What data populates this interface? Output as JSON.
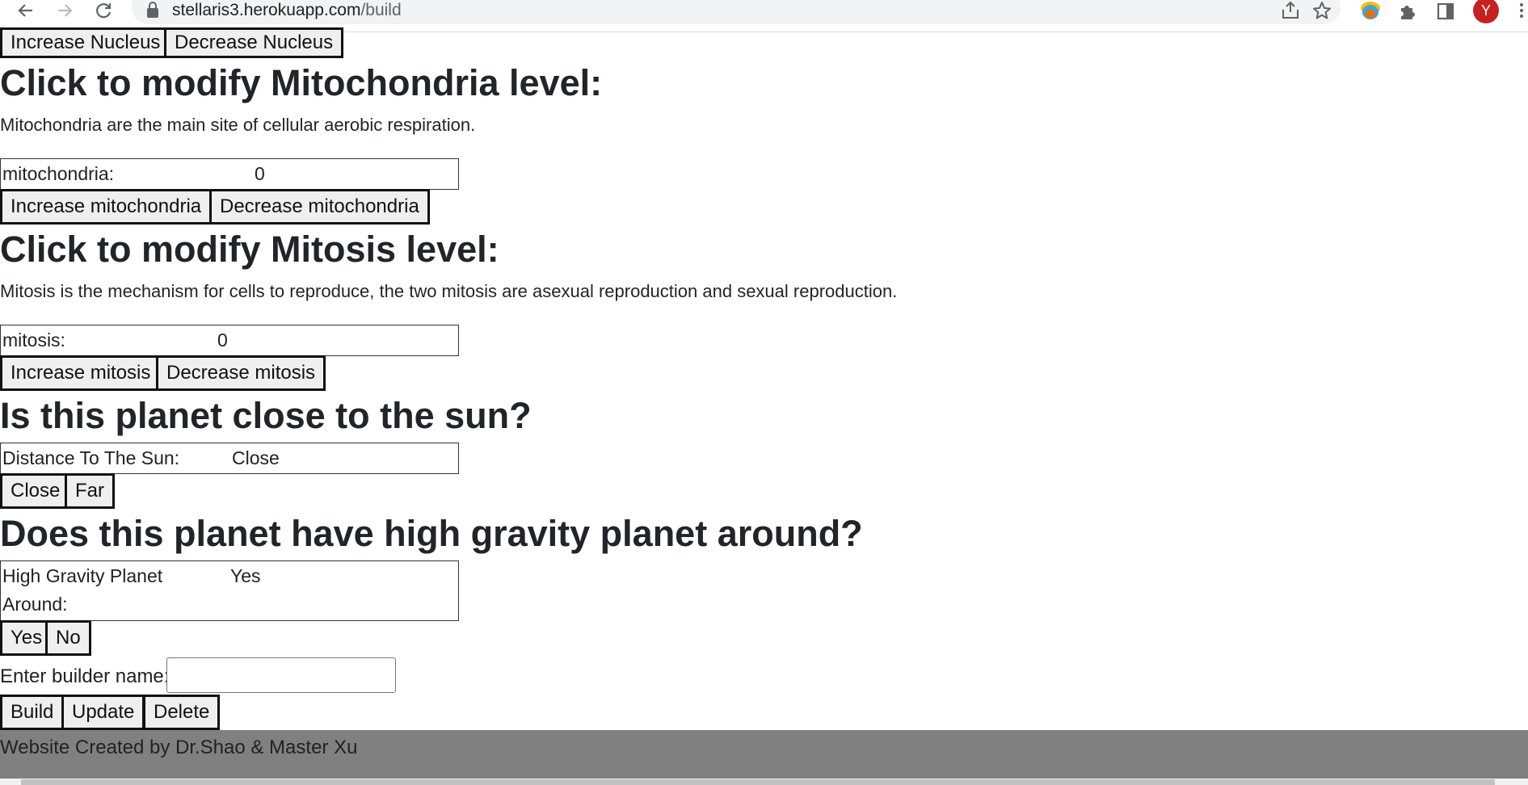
{
  "browser": {
    "url_host": "stellaris3.herokuapp.com",
    "url_path": "/build",
    "avatar_letter": "Y",
    "icons": [
      "back-icon",
      "forward-icon",
      "reload-icon",
      "lock-icon",
      "share-icon",
      "star-icon",
      "extension-colorful-icon",
      "puzzle-icon",
      "side-panel-icon",
      "kebab-menu-icon"
    ]
  },
  "nucleus": {
    "increase_label": "Increase Nucleus",
    "decrease_label": "Decrease Nucleus"
  },
  "mitochondria": {
    "heading": "Click to modify Mitochondria level:",
    "description": "Mitochondria are the main site of cellular aerobic respiration.",
    "stat_label": "mitochondria:",
    "stat_value": "0",
    "increase_label": "Increase mitochondria",
    "decrease_label": "Decrease mitochondria"
  },
  "mitosis": {
    "heading": "Click to modify Mitosis level:",
    "description": "Mitosis is the mechanism for cells to reproduce, the two mitosis are asexual reproduction and sexual reproduction.",
    "stat_label": "mitosis:",
    "stat_value": "0",
    "increase_label": "Increase mitosis",
    "decrease_label": "Decrease mitosis"
  },
  "sun": {
    "heading": "Is this planet close to the sun?",
    "stat_label": "Distance To The Sun:",
    "stat_value": "Close",
    "close_label": "Close",
    "far_label": "Far"
  },
  "gravity": {
    "heading": "Does this planet have high gravity planet around?",
    "stat_label_line1": "High Gravity Planet",
    "stat_label_line2": "Around:",
    "stat_value": "Yes",
    "yes_label": "Yes",
    "no_label": "No"
  },
  "builder": {
    "name_label": "Enter builder name:",
    "name_value": "",
    "build_label": "Build",
    "update_label": "Update",
    "delete_label": "Delete"
  },
  "footer": {
    "text": "Website Created by Dr.Shao & Master Xu"
  },
  "colors": {
    "footer_bg": "#808080",
    "avatar_bg": "#c5221f",
    "button_bg": "#efefef"
  }
}
